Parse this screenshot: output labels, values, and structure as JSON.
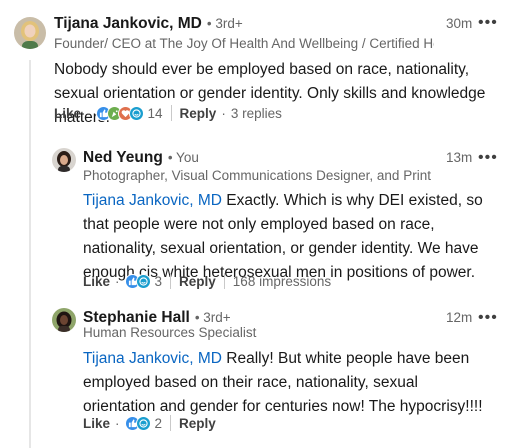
{
  "comments": [
    {
      "author": "Tijana Jankovic, MD",
      "degree": "• 3rd+",
      "headline": "Founder/ CEO at The Joy Of Health And Wellbeing / Certified Health C...",
      "time": "30m",
      "more": "•••",
      "text": "Nobody should ever be employed based on race, nationality, sexual orientation or gender identity. Only skills and knowledge matters.",
      "like_label": "Like",
      "reaction_count": "14",
      "reply_label": "Reply",
      "replies_label": "3 replies",
      "reactions": [
        "like",
        "celebrate",
        "love",
        "funny"
      ]
    }
  ],
  "replies": [
    {
      "author": "Ned Yeung",
      "degree": "• You",
      "headline": "Photographer, Visual Communications Designer, and Print Speci...",
      "time": "13m",
      "more": "•••",
      "mention": "Tijana Jankovic, MD",
      "text": " Exactly. Which is why DEI existed, so that people were not only employed based on race, nationality, sexual orientation, or gender identity. We have enough cis white heterosexual men in positions of power.",
      "like_label": "Like",
      "reaction_count": "3",
      "reply_label": "Reply",
      "impressions_label": "168 impressions",
      "reactions": [
        "like",
        "funny"
      ]
    },
    {
      "author": "Stephanie Hall",
      "degree": "• 3rd+",
      "headline": "Human Resources Specialist",
      "time": "12m",
      "more": "•••",
      "mention": "Tijana Jankovic, MD",
      "text": " Really! But white people have been employed based on their race, nationality, sexual orientation and gender for centuries now! The hypocrisy!!!!",
      "like_label": "Like",
      "reaction_count": "2",
      "reply_label": "Reply",
      "reactions": [
        "like",
        "funny"
      ]
    }
  ],
  "colors": {
    "mention": "#0a66c2",
    "like": "#378fe9",
    "celebrate": "#44712e",
    "love": "#df704d",
    "funny": "#1a9ecf"
  }
}
